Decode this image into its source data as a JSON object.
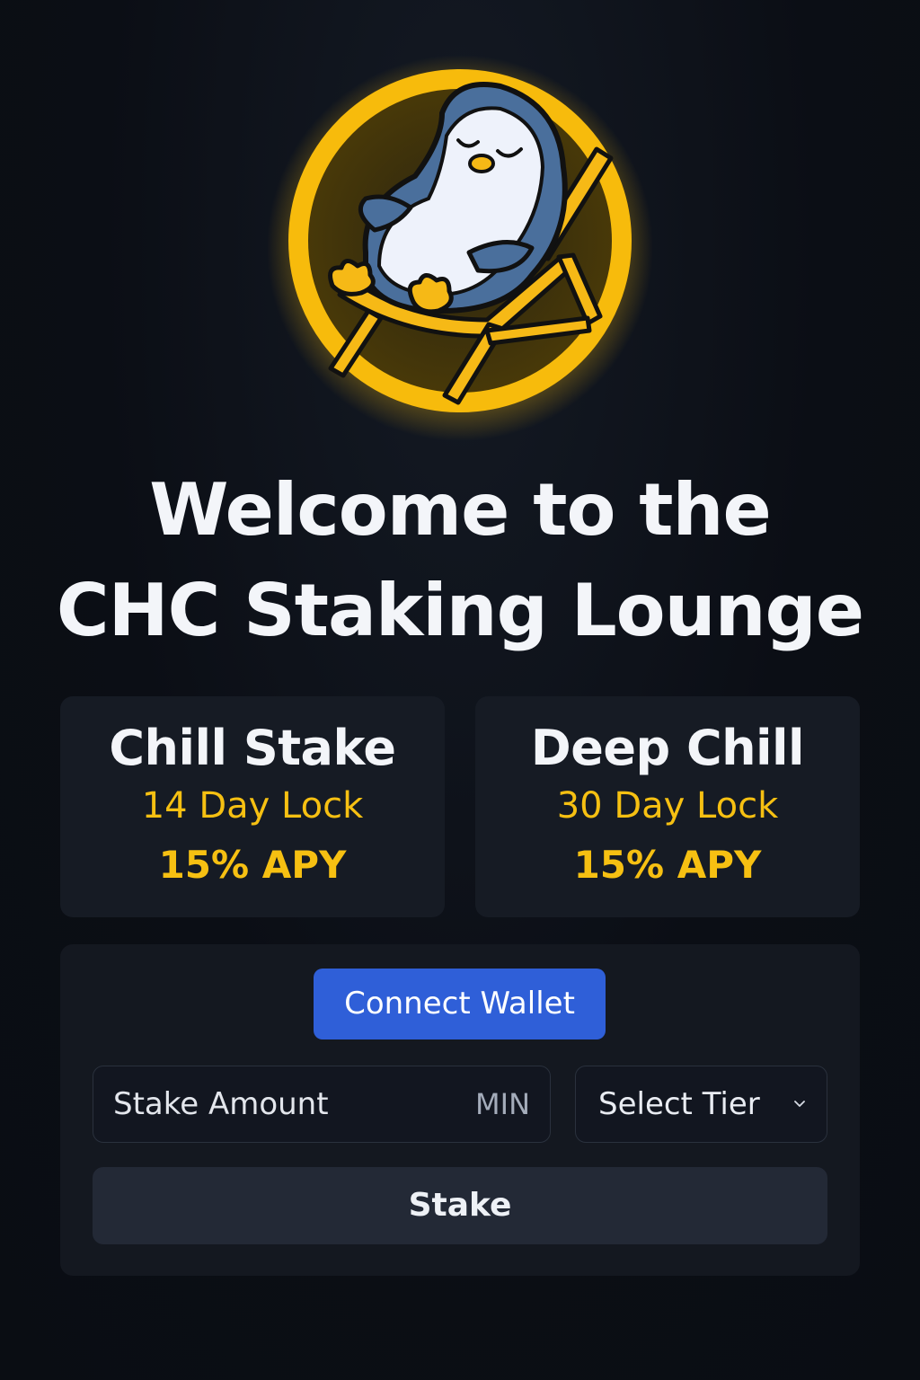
{
  "header": {
    "logo_icon": "penguin-deck-chair-logo",
    "title_line1": "Welcome to the",
    "title_line2": "CHC Staking Lounge"
  },
  "tiers": [
    {
      "name": "Chill Stake",
      "lock": "14 Day Lock",
      "apy": "15% APY"
    },
    {
      "name": "Deep Chill",
      "lock": "30 Day Lock",
      "apy": "15% APY"
    }
  ],
  "stake_form": {
    "connect_label": "Connect Wallet",
    "amount_placeholder": "Stake Amount",
    "min_label": "MIN",
    "tier_select_label": "Select Tier",
    "stake_label": "Stake"
  },
  "colors": {
    "accent": "#f6c012",
    "primary_button": "#2f5fd8",
    "background": "#0b0e15",
    "card": "#161b24"
  }
}
